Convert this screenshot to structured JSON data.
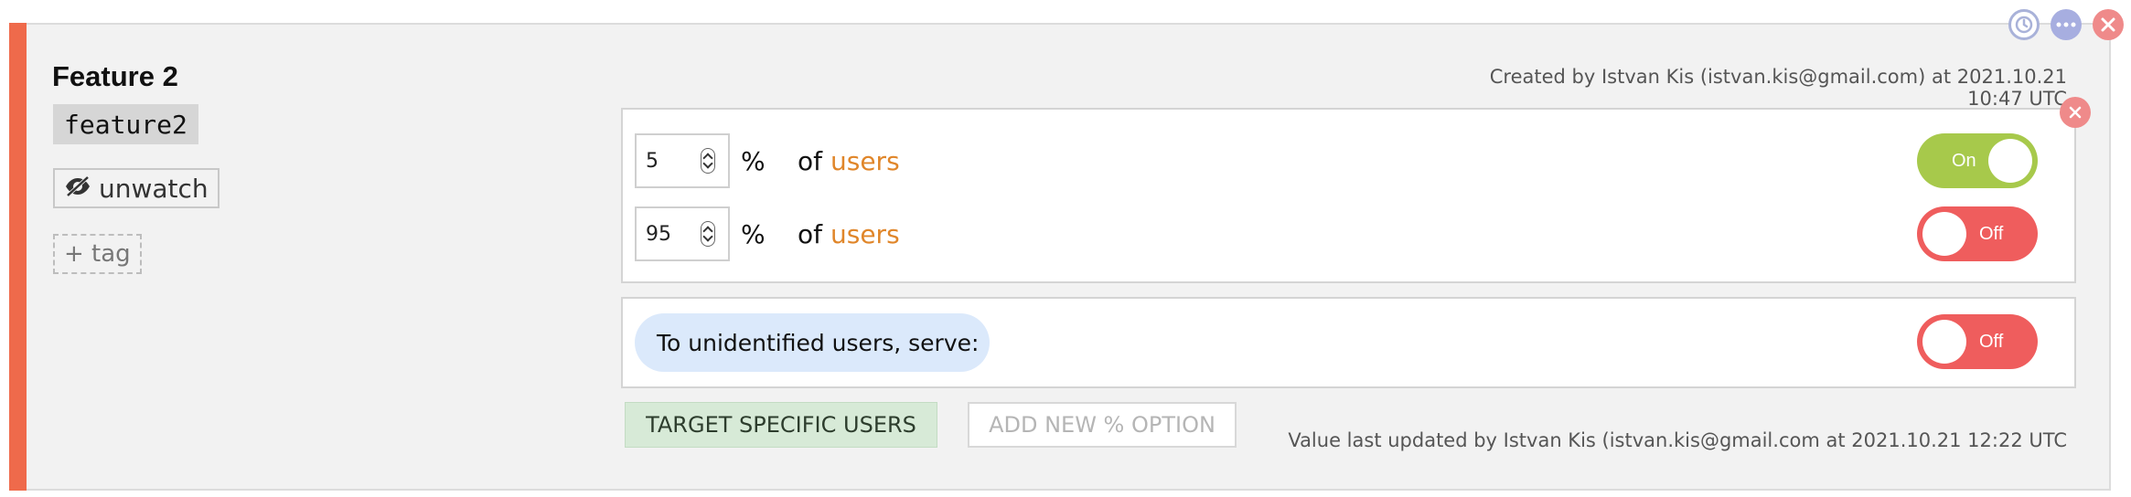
{
  "feature": {
    "title": "Feature 2",
    "key": "feature2",
    "unwatch_label": "unwatch",
    "tag_label": "+ tag",
    "created_by": "Created by Istvan Kis (istvan.kis@gmail.com) at 2021.10.21 10:47 UTC",
    "updated_by": "Value last updated by Istvan Kis (istvan.kis@gmail.com at 2021.10.21 12:22 UTC"
  },
  "top_icons": [
    "history-icon",
    "more-icon",
    "close-icon"
  ],
  "rules": [
    {
      "percent": "5",
      "percent_sign": "%",
      "of": "of",
      "users": "users",
      "toggle": "On",
      "state": "on"
    },
    {
      "percent": "95",
      "percent_sign": "%",
      "of": "of",
      "users": "users",
      "toggle": "Off",
      "state": "off"
    }
  ],
  "unidentified": {
    "label": "To unidentified users, serve:",
    "toggle": "Off"
  },
  "buttons": {
    "target_specific": "TARGET SPECIFIC USERS",
    "add_option": "ADD NEW % OPTION"
  },
  "colors": {
    "accent": "#ef6a4b",
    "on": "#a7c94b",
    "off": "#ef5d5d",
    "users_link": "#e0862a",
    "serve_pill": "#dbe9fb",
    "target_button": "#d7ead7"
  }
}
